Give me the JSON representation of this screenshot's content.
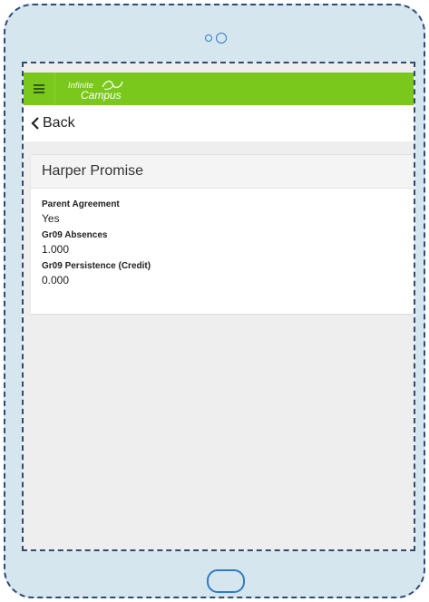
{
  "app": {
    "logo_line1": "Infinite",
    "logo_line2": "Campus",
    "accent": "#7ac81c"
  },
  "nav": {
    "menu_icon": "hamburger-icon",
    "back_icon": "chevron-left-icon",
    "back_label": "Back"
  },
  "card": {
    "title": "Harper Promise",
    "fields": [
      {
        "label": "Parent Agreement",
        "value": "Yes"
      },
      {
        "label": "Gr09 Absences",
        "value": "1.000"
      },
      {
        "label": "Gr09 Persistence (Credit)",
        "value": "0.000"
      }
    ]
  }
}
